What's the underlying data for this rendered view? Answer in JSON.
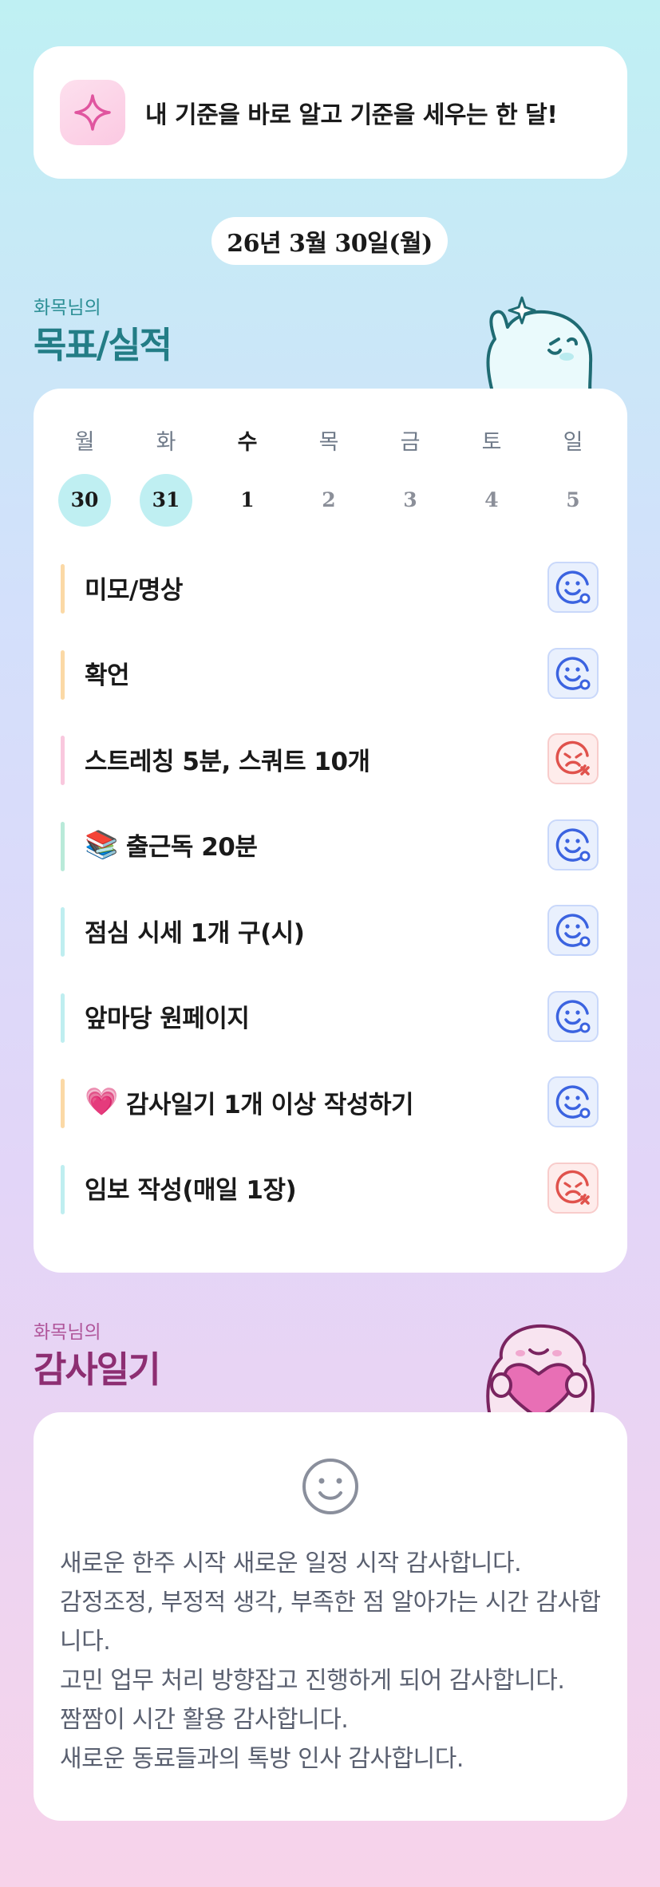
{
  "header": {
    "icon": "sparkle-icon",
    "title": "내 기준을 바로 알고 기준을 세우는 한 달!"
  },
  "date_label": "26년 3월 30일(월)",
  "goals_section": {
    "subtitle": "화목님의",
    "title": "목표/실적"
  },
  "calendar": {
    "weekdays": [
      "월",
      "화",
      "수",
      "목",
      "금",
      "토",
      "일"
    ],
    "dates": [
      "30",
      "31",
      "1",
      "2",
      "3",
      "4",
      "5"
    ],
    "completed_days": [
      "30",
      "31"
    ],
    "today": "1"
  },
  "goals": [
    {
      "label": "미모/명상",
      "emoji": "",
      "bar_color": "#fbd9a6",
      "status": "done"
    },
    {
      "label": "확언",
      "emoji": "",
      "bar_color": "#fbd9a6",
      "status": "done"
    },
    {
      "label": "스트레칭 5분, 스쿼트 10개",
      "emoji": "",
      "bar_color": "#f9c8de",
      "status": "missed"
    },
    {
      "label": "출근독 20분",
      "emoji": "📚",
      "bar_color": "#b9ead9",
      "status": "done"
    },
    {
      "label": "점심 시세 1개 구(시)",
      "emoji": "",
      "bar_color": "#bfeef0",
      "status": "done"
    },
    {
      "label": "앞마당 원페이지",
      "emoji": "",
      "bar_color": "#bfeef0",
      "status": "done"
    },
    {
      "label": "감사일기 1개 이상 작성하기",
      "emoji": "💗",
      "bar_color": "#fbd9a6",
      "status": "done"
    },
    {
      "label": "임보 작성(매일 1장)",
      "emoji": "",
      "bar_color": "#bfeef0",
      "status": "missed"
    }
  ],
  "gratitude_section": {
    "subtitle": "화목님의",
    "title": "감사일기"
  },
  "gratitude": {
    "mood_icon": "smile-face-icon",
    "text": "새로운 한주 시작 새로운 일정 시작 감사합니다.\n감정조정, 부정적 생각, 부족한 점 알아가는 시간 감사합니다.\n고민 업무 처리 방향잡고 진행하게 되어 감사합니다.\n짬짬이 시간 활용 감사합니다.\n새로운 동료들과의 톡방 인사 감사합니다."
  },
  "colors": {
    "teal_title": "#237d86",
    "plum_title": "#8d2e72",
    "done_blue": "#3b63e0",
    "missed_red": "#e0524c"
  }
}
